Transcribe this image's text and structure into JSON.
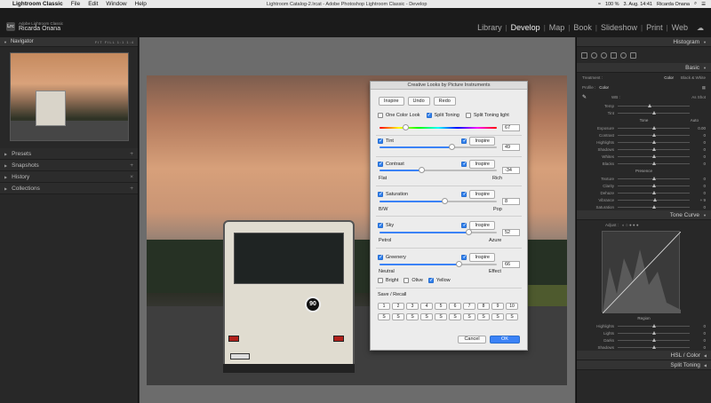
{
  "menubar": {
    "app": "Lightroom Classic",
    "menus": [
      "File",
      "Edit",
      "Window",
      "Help"
    ],
    "window_title": "Lightroom Catalog-2.lrcat - Adobe Photoshop Lightroom Classic - Develop",
    "battery": "100 %",
    "date_time": "3. Aug. 14:41",
    "user": "Ricarda Onana"
  },
  "header": {
    "logo": "Lrc",
    "brand_small": "Adobe Lightroom Classic",
    "user_name": "Ricarda Onana",
    "modules": [
      "Library",
      "Develop",
      "Map",
      "Book",
      "Slideshow",
      "Print",
      "Web"
    ],
    "active_module": "Develop"
  },
  "left_panel": {
    "navigator_title": "Navigator",
    "navigator_options": "FIT  FILL  1:1  1:4",
    "sections": [
      "Presets",
      "Snapshots",
      "History",
      "Collections"
    ]
  },
  "photo": {
    "plate_number": "90"
  },
  "dialog": {
    "title": "Creative Looks by Picture Instruments",
    "top_buttons": [
      "Inspire",
      "Undo",
      "Redo"
    ],
    "one_color_look": {
      "label": "One Color Look",
      "checked": false
    },
    "split_toning": {
      "label": "Split Toning",
      "checked": true
    },
    "split_toning_light": {
      "label": "Split Toning light",
      "checked": false
    },
    "hue_value": "67",
    "hue_fraction": 0.22,
    "tint": {
      "label": "Tint",
      "checked": true,
      "inspire_label": "Inspire",
      "inspire_checked": true,
      "value": "49",
      "fraction": 0.62
    },
    "contrast": {
      "label": "Contrast",
      "checked": true,
      "inspire_label": "Inspire",
      "inspire_checked": true,
      "value": "-34",
      "fraction": 0.36,
      "min_label": "Flat",
      "max_label": "Rich"
    },
    "saturation": {
      "label": "Saturation",
      "checked": true,
      "inspire_label": "Inspire",
      "inspire_checked": true,
      "value": "8",
      "fraction": 0.56,
      "min_label": "B/W",
      "max_label": "Pop"
    },
    "sky": {
      "label": "Sky",
      "checked": true,
      "inspire_label": "Inspire",
      "inspire_checked": true,
      "value": "52",
      "fraction": 0.76,
      "min_label": "Petrol",
      "max_label": "Azure"
    },
    "greenery": {
      "label": "Greenery",
      "checked": true,
      "inspire_label": "Inspire",
      "inspire_checked": true,
      "value": "66",
      "fraction": 0.68,
      "min_label": "Neutral",
      "max_label": "Effect"
    },
    "options": [
      {
        "label": "Bright",
        "checked": false
      },
      {
        "label": "Olive",
        "checked": false
      },
      {
        "label": "Yellow",
        "checked": true
      }
    ],
    "save_recall_label": "Save / Recall",
    "slots": [
      "1",
      "2",
      "3",
      "4",
      "5",
      "6",
      "7",
      "8",
      "9",
      "10"
    ],
    "save_label": "S",
    "cancel_label": "Cancel",
    "ok_label": "OK"
  },
  "right_panel": {
    "histogram_title": "Histogram",
    "basic_title": "Basic",
    "treatment_label": "Treatment :",
    "treatment_options": [
      "Color",
      "Black & White"
    ],
    "profile_label": "Profile :",
    "profile_value": "Color",
    "wb_label": "WB :",
    "wb_value": "As Shot",
    "basic_rows": [
      {
        "label": "Temp",
        "pos": 0.45,
        "value": ""
      },
      {
        "label": "Tint",
        "pos": 0.5,
        "value": ""
      }
    ],
    "tone_label": "Tone",
    "auto_label": "Auto",
    "tone_rows": [
      {
        "label": "Exposure",
        "pos": 0.5,
        "value": "0.00"
      },
      {
        "label": "Contrast",
        "pos": 0.5,
        "value": "0"
      },
      {
        "label": "Highlights",
        "pos": 0.5,
        "value": "0"
      },
      {
        "label": "Shadows",
        "pos": 0.5,
        "value": "0"
      },
      {
        "label": "Whites",
        "pos": 0.5,
        "value": "0"
      },
      {
        "label": "Blacks",
        "pos": 0.5,
        "value": "0"
      }
    ],
    "presence_label": "Presence",
    "presence_rows": [
      {
        "label": "Texture",
        "pos": 0.5,
        "value": "0"
      },
      {
        "label": "Clarity",
        "pos": 0.5,
        "value": "0"
      },
      {
        "label": "Dehaze",
        "pos": 0.5,
        "value": "0"
      },
      {
        "label": "Vibrance",
        "pos": 0.52,
        "value": "+ 9"
      },
      {
        "label": "Saturation",
        "pos": 0.5,
        "value": "0"
      }
    ],
    "tone_curve_title": "Tone Curve",
    "adjust_label": "Adjust :",
    "region_label": "Region",
    "region_rows": [
      {
        "label": "Highlights",
        "pos": 0.5,
        "value": "0"
      },
      {
        "label": "Lights",
        "pos": 0.5,
        "value": "0"
      },
      {
        "label": "Darks",
        "pos": 0.5,
        "value": "0"
      },
      {
        "label": "Shadows",
        "pos": 0.5,
        "value": "0"
      }
    ],
    "hsl_title": "HSL / Color",
    "split_toning_title": "Split Toning"
  }
}
